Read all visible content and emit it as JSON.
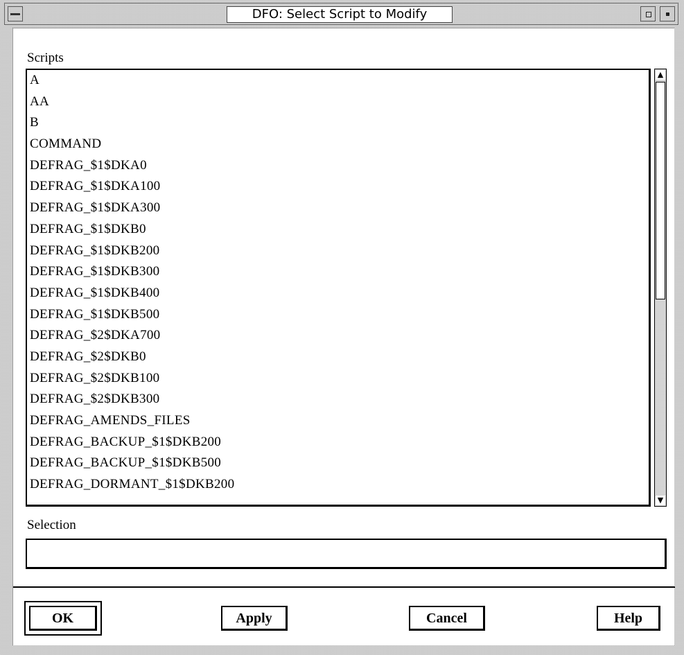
{
  "window": {
    "title": "DFO: Select Script to Modify"
  },
  "scripts": {
    "label": "Scripts",
    "items": [
      "A",
      "AA",
      "B",
      "COMMAND",
      "DEFRAG_$1$DKA0",
      "DEFRAG_$1$DKA100",
      "DEFRAG_$1$DKA300",
      "DEFRAG_$1$DKB0",
      "DEFRAG_$1$DKB200",
      "DEFRAG_$1$DKB300",
      "DEFRAG_$1$DKB400",
      "DEFRAG_$1$DKB500",
      "DEFRAG_$2$DKA700",
      "DEFRAG_$2$DKB0",
      "DEFRAG_$2$DKB100",
      "DEFRAG_$2$DKB300",
      "DEFRAG_AMENDS_FILES",
      "DEFRAG_BACKUP_$1$DKB200",
      "DEFRAG_BACKUP_$1$DKB500",
      "DEFRAG_DORMANT_$1$DKB200"
    ]
  },
  "selection": {
    "label": "Selection",
    "value": ""
  },
  "buttons": {
    "ok": "OK",
    "apply": "Apply",
    "cancel": "Cancel",
    "help": "Help"
  },
  "icons": {
    "window_menu": "window-menu-icon",
    "maximize": "maximize-icon",
    "close": "close-icon",
    "scroll_up": "arrow-up-icon",
    "scroll_down": "arrow-down-icon"
  }
}
